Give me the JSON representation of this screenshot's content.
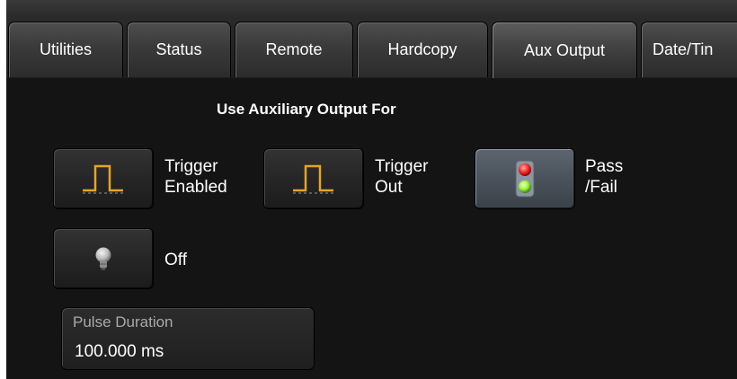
{
  "tabs": [
    {
      "id": "utilities",
      "label": "Utilities",
      "active": false
    },
    {
      "id": "status",
      "label": "Status",
      "active": false
    },
    {
      "id": "remote",
      "label": "Remote",
      "active": false
    },
    {
      "id": "hardcopy",
      "label": "Hardcopy",
      "active": false
    },
    {
      "id": "aux-output",
      "label": "Aux Output",
      "active": true
    },
    {
      "id": "date-time",
      "label": "Date/Tin",
      "active": false
    }
  ],
  "aux_output": {
    "section_title": "Use Auxiliary Output For",
    "options": [
      {
        "id": "trigger-enabled",
        "line1": "Trigger",
        "line2": "Enabled",
        "icon": "pulse-icon",
        "selected": false
      },
      {
        "id": "trigger-out",
        "line1": "Trigger",
        "line2": "Out",
        "icon": "pulse-icon",
        "selected": false
      },
      {
        "id": "pass-fail",
        "line1": "Pass",
        "line2": "/Fail",
        "icon": "traffic-light-icon",
        "selected": true
      },
      {
        "id": "off",
        "line1": "Off",
        "line2": "",
        "icon": "bulb-off-icon",
        "selected": false
      }
    ],
    "pulse_duration": {
      "label": "Pulse Duration",
      "value": "100.000 ms"
    }
  },
  "colors": {
    "background": "#141414",
    "pulse_trace": "#e8a422",
    "light_red": "#ff2a2a",
    "light_green": "#9af53a"
  }
}
